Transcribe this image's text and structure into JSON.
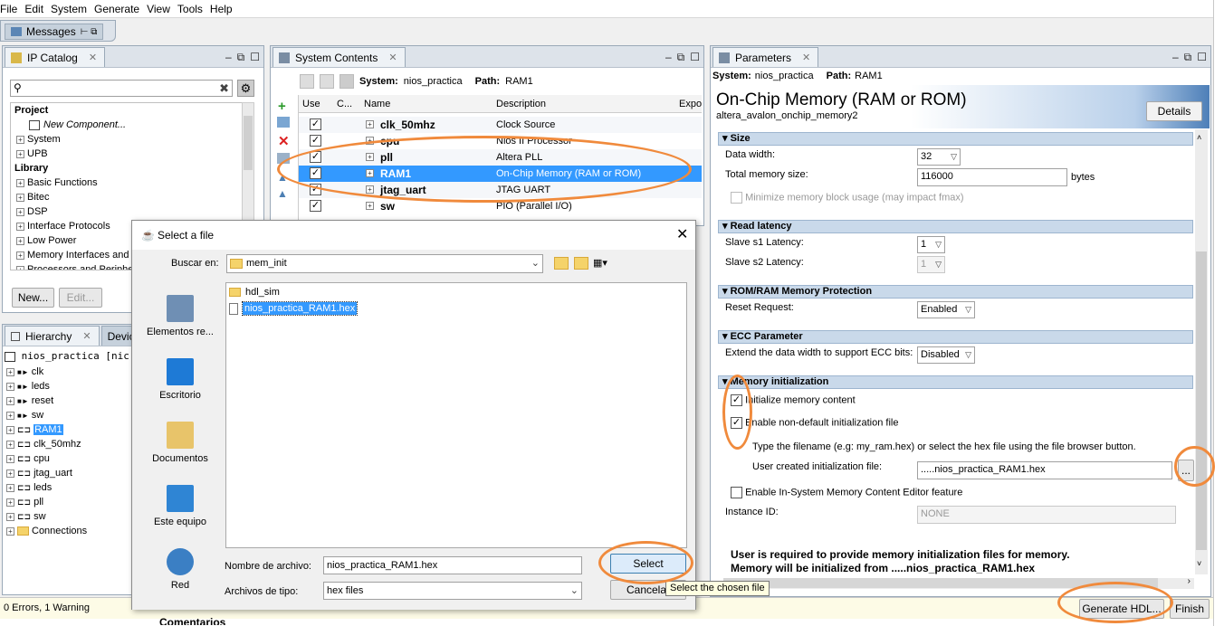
{
  "menu": [
    "File",
    "Edit",
    "System",
    "Generate",
    "View",
    "Tools",
    "Help"
  ],
  "messages_tab": "Messages",
  "ip_catalog": {
    "tab": "IP Catalog",
    "search_value": "",
    "tree": [
      {
        "label": "Project",
        "bold": true,
        "level": 0
      },
      {
        "label": "New Component...",
        "italic": true,
        "level": 2
      },
      {
        "label": "System",
        "level": 1,
        "plus": true
      },
      {
        "label": "UPB",
        "level": 1,
        "plus": true
      },
      {
        "label": "Library",
        "bold": true,
        "level": 0
      },
      {
        "label": "Basic Functions",
        "level": 1,
        "plus": true
      },
      {
        "label": "Bitec",
        "level": 1,
        "plus": true
      },
      {
        "label": "DSP",
        "level": 1,
        "plus": true
      },
      {
        "label": "Interface Protocols",
        "level": 1,
        "plus": true
      },
      {
        "label": "Low Power",
        "level": 1,
        "plus": true
      },
      {
        "label": "Memory Interfaces and",
        "level": 1,
        "plus": true
      },
      {
        "label": "Processors and Periphe",
        "level": 1,
        "plus": true
      }
    ],
    "new_btn": "New...",
    "edit_btn": "Edit..."
  },
  "hierarchy": {
    "tab": "Hierarchy",
    "tab2": "Devic",
    "root": "nios_practica [nic",
    "items": [
      "clk",
      "leds",
      "reset",
      "sw",
      "RAM1",
      "clk_50mhz",
      "cpu",
      "jtag_uart",
      "leds",
      "pll",
      "sw",
      "Connections"
    ]
  },
  "system_contents": {
    "tab": "System Contents",
    "system_label": "System:",
    "system_value": "nios_practica",
    "path_label": "Path:",
    "path_value": "RAM1",
    "columns": [
      "Use",
      "C...",
      "Name",
      "Description",
      "Expo"
    ],
    "rows": [
      {
        "name": "clk_50mhz",
        "desc": "Clock Source",
        "checked": true
      },
      {
        "name": "cpu",
        "desc": "Nios II Processor",
        "checked": true
      },
      {
        "name": "pll",
        "desc": "Altera PLL",
        "checked": true
      },
      {
        "name": "RAM1",
        "desc": "On-Chip Memory (RAM or ROM)",
        "checked": true,
        "selected": true
      },
      {
        "name": "jtag_uart",
        "desc": "JTAG UART",
        "checked": true
      },
      {
        "name": "sw",
        "desc": "PIO (Parallel I/O)",
        "checked": true
      }
    ]
  },
  "parameters": {
    "tab": "Parameters",
    "system_label": "System:",
    "system_value": "nios_practica",
    "path_label": "Path:",
    "path_value": "RAM1",
    "title": "On-Chip Memory (RAM or ROM)",
    "subtitle": "altera_avalon_onchip_memory2",
    "details_btn": "Details",
    "size": {
      "header": "Size",
      "data_width_label": "Data width:",
      "data_width": "32",
      "total_label": "Total memory size:",
      "total_value": "116000",
      "total_unit": "bytes",
      "minimize_label": "Minimize memory block usage (may impact fmax)"
    },
    "latency": {
      "header": "Read latency",
      "s1_label": "Slave s1 Latency:",
      "s1_value": "1",
      "s2_label": "Slave s2 Latency:",
      "s2_value": "1"
    },
    "protection": {
      "header": "ROM/RAM Memory Protection",
      "reset_label": "Reset Request:",
      "reset_value": "Enabled"
    },
    "ecc": {
      "header": "ECC Parameter",
      "extend_label": "Extend the data width to support ECC bits:",
      "extend_value": "Disabled"
    },
    "init": {
      "header": "Memory initialization",
      "init_content": "Initialize memory content",
      "non_default": "Enable non-default initialization file",
      "hint": "Type the filename (e.g: my_ram.hex) or select the hex file using the file browser button.",
      "user_file_label": "User created initialization file:",
      "user_file_value": ".....nios_practica_RAM1.hex",
      "browse": "...",
      "insystem": "Enable In-System Memory Content Editor feature",
      "instance_label": "Instance ID:",
      "instance_value": "NONE"
    },
    "message_line1": "User is required to provide memory initialization files for memory.",
    "message_line2": "Memory will be initialized from .....nios_practica_RAM1.hex"
  },
  "status": {
    "text": "0 Errors, 1 Warning",
    "generate_btn": "Generate HDL...",
    "finish_btn": "Finish",
    "bottom_fragment": "Comentarios"
  },
  "dialog": {
    "title": "Select a file",
    "lookin_label": "Buscar en:",
    "lookin_value": "mem_init",
    "places": [
      "Elementos re...",
      "Escritorio",
      "Documentos",
      "Este equipo",
      "Red"
    ],
    "files": [
      {
        "name": "hdl_sim",
        "type": "folder"
      },
      {
        "name": "nios_practica_RAM1.hex",
        "type": "file",
        "selected": true
      }
    ],
    "filename_label": "Nombre de archivo:",
    "filename_value": "nios_practica_RAM1.hex",
    "filetype_label": "Archivos de tipo:",
    "filetype_value": "hex files",
    "select_btn": "Select",
    "cancel_btn": "Cancelar",
    "tooltip": "Select the chosen file"
  },
  "colors": {
    "accent_oval": "#f08a3c",
    "selection": "#3399ff",
    "section_header": "#c9d9ea"
  }
}
